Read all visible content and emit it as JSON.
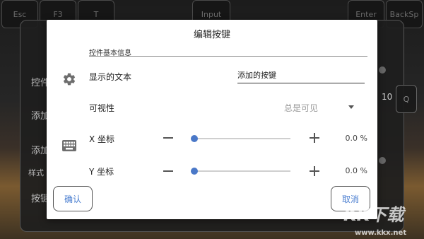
{
  "background_keys": [
    "Esc",
    "F3",
    "T",
    "Input",
    "Enter",
    "BackSp"
  ],
  "background_panel": {
    "items": [
      "控件",
      "添加",
      "添加",
      "样式",
      "按键"
    ],
    "right_value": "10",
    "right_button": "Q"
  },
  "dialog": {
    "title": "编辑按键",
    "section_label": "控件基本信息",
    "text_row": {
      "label": "显示的文本",
      "value": "添加的按键"
    },
    "visibility_row": {
      "label": "可视性",
      "selected": "总是可见"
    },
    "x_row": {
      "label": "X 坐标",
      "value": "0.0 %",
      "position": 0.0
    },
    "y_row": {
      "label": "Y 坐标",
      "value": "0.0 %",
      "position": 0.0
    },
    "confirm_label": "确认",
    "cancel_label": "取消"
  },
  "watermark": {
    "text": "KK下载",
    "url": "www.kkx.net"
  },
  "colors": {
    "accent": "#4a78c8",
    "button_text": "#4a7ed0"
  },
  "icons": [
    "gear-icon",
    "keyboard-icon",
    "minus-icon",
    "plus-icon",
    "chevron-down-icon"
  ]
}
